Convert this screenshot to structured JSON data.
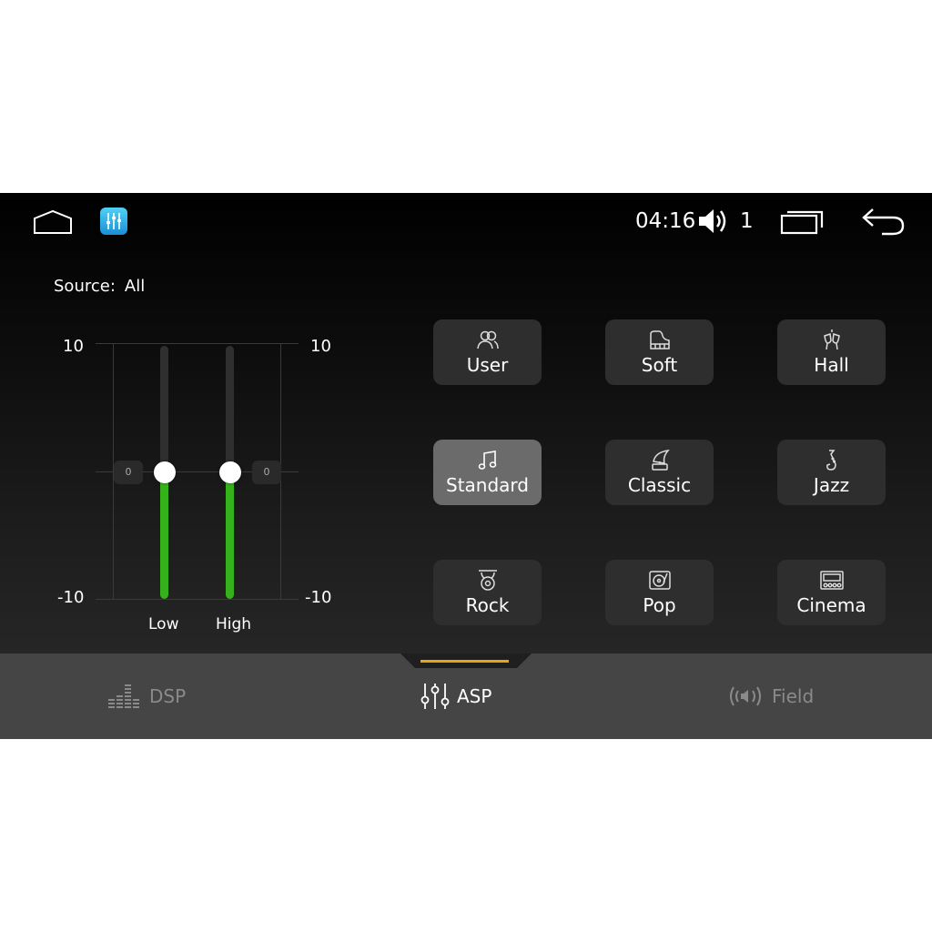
{
  "status": {
    "time": "04:16",
    "volume_level": "1"
  },
  "source": {
    "label": "Source:",
    "value": "All"
  },
  "eq": {
    "scale_max": "10",
    "scale_min": "-10",
    "bands": [
      {
        "label": "Low",
        "value": "0"
      },
      {
        "label": "High",
        "value": "0"
      }
    ]
  },
  "presets": [
    {
      "label": "User",
      "icon": "users-icon"
    },
    {
      "label": "Soft",
      "icon": "piano-icon"
    },
    {
      "label": "Hall",
      "icon": "cheers-icon"
    },
    {
      "label": "Standard",
      "icon": "music-note-icon",
      "selected": true
    },
    {
      "label": "Classic",
      "icon": "gramophone-icon"
    },
    {
      "label": "Jazz",
      "icon": "saxophone-icon"
    },
    {
      "label": "Rock",
      "icon": "drum-icon"
    },
    {
      "label": "Pop",
      "icon": "turntable-icon"
    },
    {
      "label": "Cinema",
      "icon": "theater-icon"
    }
  ],
  "tabs": [
    {
      "label": "DSP",
      "icon": "equalizer-bars-icon"
    },
    {
      "label": "ASP",
      "icon": "sliders-icon",
      "selected": true
    },
    {
      "label": "Field",
      "icon": "sound-field-icon"
    }
  ],
  "colors": {
    "accent": "#e7a51a",
    "level_fill": "#35b21b",
    "app_icon": "#2aa8e8"
  }
}
